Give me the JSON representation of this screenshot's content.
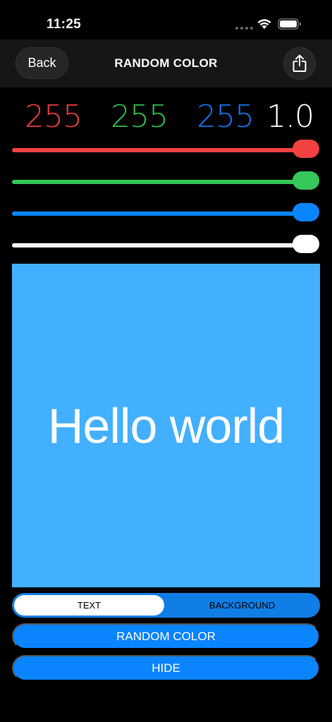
{
  "status_bar": {
    "time": "11:25",
    "icons": [
      "signal-dots-icon",
      "wifi-icon",
      "battery-icon"
    ]
  },
  "nav": {
    "back_label": "Back",
    "title": "RANDOM COLOR",
    "share_icon": "share-icon"
  },
  "values": {
    "red": "255",
    "green": "255",
    "blue": "255",
    "alpha": "1.0"
  },
  "sliders": {
    "red": 1.0,
    "green": 1.0,
    "blue": 1.0,
    "alpha": 1.0
  },
  "colors": {
    "red": "#f44141",
    "green": "#35c759",
    "blue": "#0a84ff",
    "preview_background": "#42b0ff",
    "preview_text": "#ffffff"
  },
  "preview": {
    "text": "Hello world"
  },
  "segmented": {
    "options": [
      "TEXT",
      "BACKGROUND"
    ],
    "selected": "TEXT"
  },
  "buttons": {
    "random_label": "RANDOM COLOR",
    "hide_label": "HIDE"
  }
}
